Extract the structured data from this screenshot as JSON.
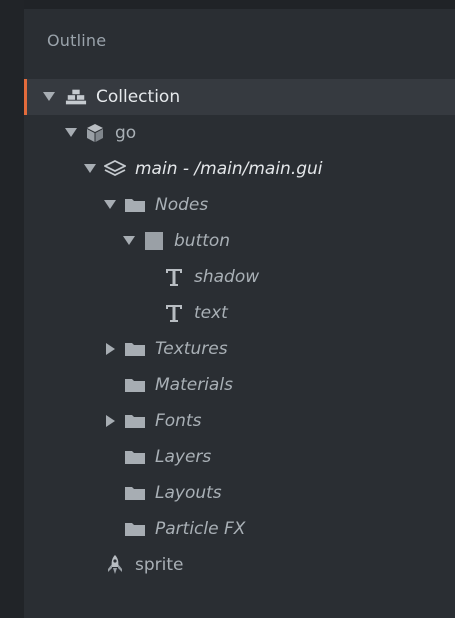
{
  "panel": {
    "title": "Outline"
  },
  "tree": {
    "collection": {
      "label": "Collection",
      "icon": "collection-icon",
      "expanded": true,
      "selected": true
    },
    "go": {
      "label": "go",
      "icon": "cube-icon",
      "expanded": true
    },
    "main": {
      "label": "main - /main/main.gui",
      "icon": "layers-icon",
      "expanded": true
    },
    "nodes": {
      "label": "Nodes",
      "icon": "folder-icon",
      "expanded": true
    },
    "button": {
      "label": "button",
      "icon": "box-icon",
      "expanded": true
    },
    "shadow": {
      "label": "shadow",
      "icon": "text-icon"
    },
    "text": {
      "label": "text",
      "icon": "text-icon"
    },
    "textures": {
      "label": "Textures",
      "icon": "folder-icon",
      "expanded": false
    },
    "materials": {
      "label": "Materials",
      "icon": "folder-icon"
    },
    "fonts": {
      "label": "Fonts",
      "icon": "folder-icon",
      "expanded": false
    },
    "layers": {
      "label": "Layers",
      "icon": "folder-icon"
    },
    "layouts": {
      "label": "Layouts",
      "icon": "folder-icon"
    },
    "particlefx": {
      "label": "Particle FX",
      "icon": "folder-icon"
    },
    "sprite": {
      "label": "sprite",
      "icon": "rocket-icon"
    }
  },
  "colors": {
    "accent": "#e36b3c",
    "panel_bg": "#2a2e33",
    "selected_bg": "#363a40",
    "text": "#a9b0b6"
  }
}
